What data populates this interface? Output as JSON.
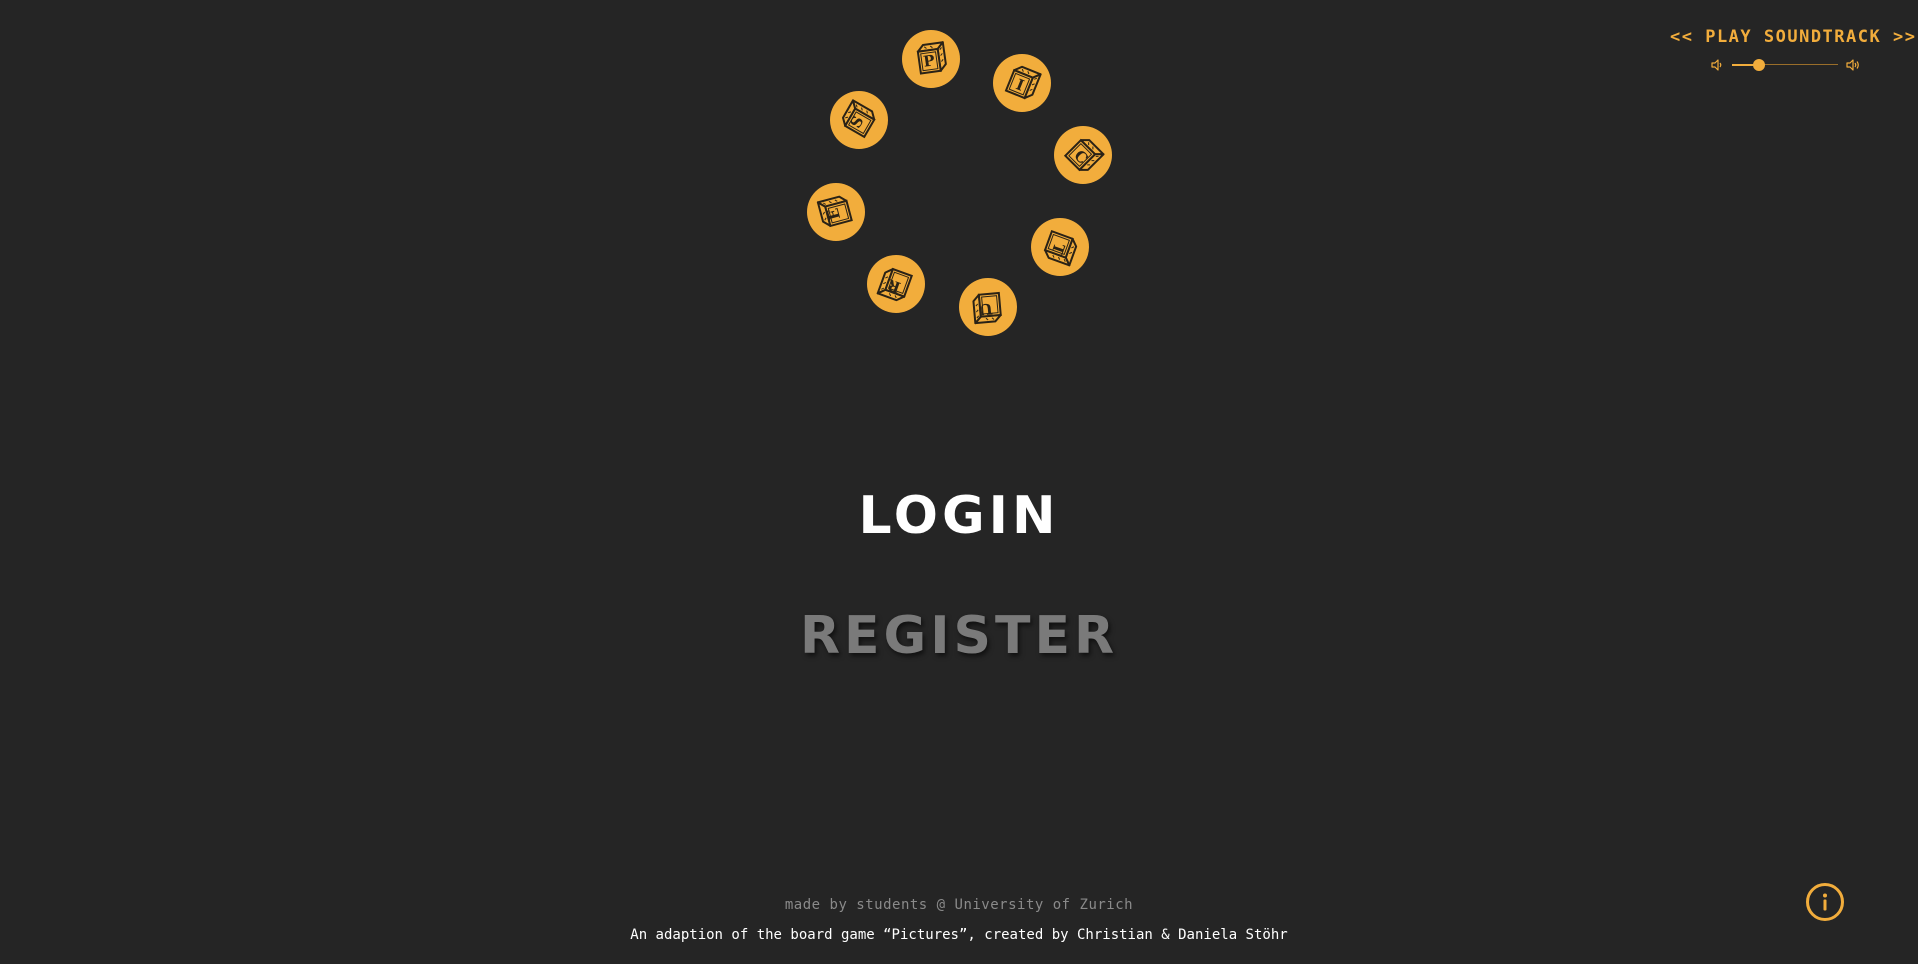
{
  "logo": {
    "letters": [
      "P",
      "I",
      "C",
      "T",
      "U",
      "R",
      "E",
      "S"
    ],
    "colors": {
      "disc": "#f2ad3c",
      "ink": "#2a2216"
    }
  },
  "soundtrack": {
    "label": "<< PLAY SOUNDTRACK >>",
    "volume_level": 0.25,
    "volume_low_icon": "volume-low-icon",
    "volume_high_icon": "volume-high-icon"
  },
  "menu": {
    "login_label": "LOGIN",
    "register_label": "REGISTER"
  },
  "footer": {
    "credit": "made by students @ University of Zurich",
    "adaption": "An adaption of the board game “Pictures”, created by Christian & Daniela Stöhr"
  },
  "info": {
    "icon": "info-icon"
  },
  "colors": {
    "background": "#252525",
    "accent": "#f2ad3c",
    "text_primary": "#ffffff",
    "text_muted": "#8a8a8a",
    "register_gray": "#7a7a7a"
  }
}
